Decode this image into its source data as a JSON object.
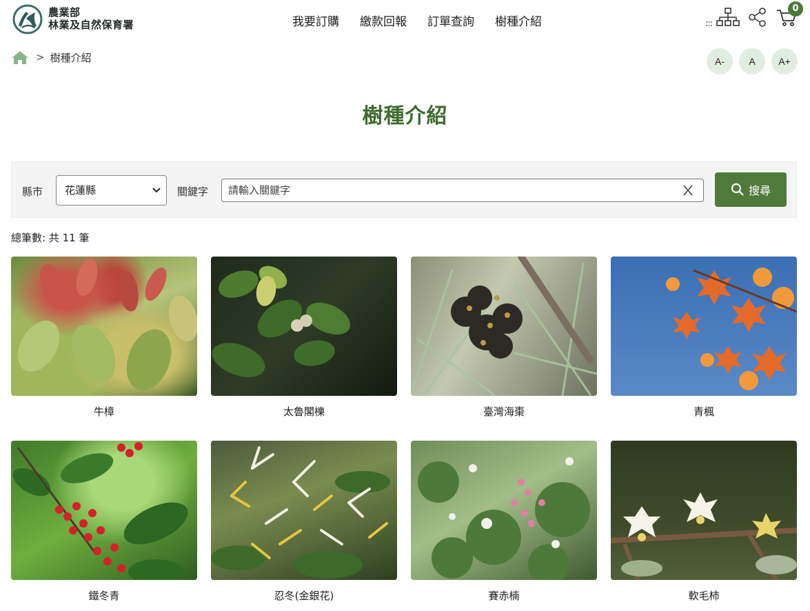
{
  "header": {
    "org_line1": "農業部",
    "org_line2": "林業及自然保育署",
    "nav": [
      "我要訂購",
      "繳款回報",
      "訂單查詢",
      "樹種介紹"
    ],
    "menu_dots": ":::",
    "cart_count": "0"
  },
  "breadcrumb": {
    "current": "樹種介紹",
    "separator": ">"
  },
  "font_sizes": [
    "A-",
    "A",
    "A+"
  ],
  "title": "樹種介紹",
  "search": {
    "county_label": "縣市",
    "county_value": "花蓮縣",
    "keyword_label": "關鍵字",
    "keyword_placeholder": "請輸入關鍵字",
    "button_label": "搜尋"
  },
  "total_text": "總筆數: 共 11 筆",
  "trees": [
    {
      "name": "牛樟",
      "photo": "reddish new leaves on green foliage"
    },
    {
      "name": "太魯閣櫟",
      "photo": "oak leaves with acorns"
    },
    {
      "name": "臺灣海棗",
      "photo": "palm fruit cluster"
    },
    {
      "name": "青楓",
      "photo": "orange maple leaves against blue sky"
    },
    {
      "name": "鐵冬青",
      "photo": "red berries with glossy leaves"
    },
    {
      "name": "忍冬(金銀花)",
      "photo": "white and yellow honeysuckle flowers"
    },
    {
      "name": "賽赤楠",
      "photo": "shrub with pink new shoots"
    },
    {
      "name": "軟毛柿",
      "photo": "small white flowers on a branch"
    }
  ],
  "colors": {
    "brand_green": "#4e7b3b",
    "title_green": "#3e6b2e",
    "font_btn_bg": "#e1ede0"
  }
}
